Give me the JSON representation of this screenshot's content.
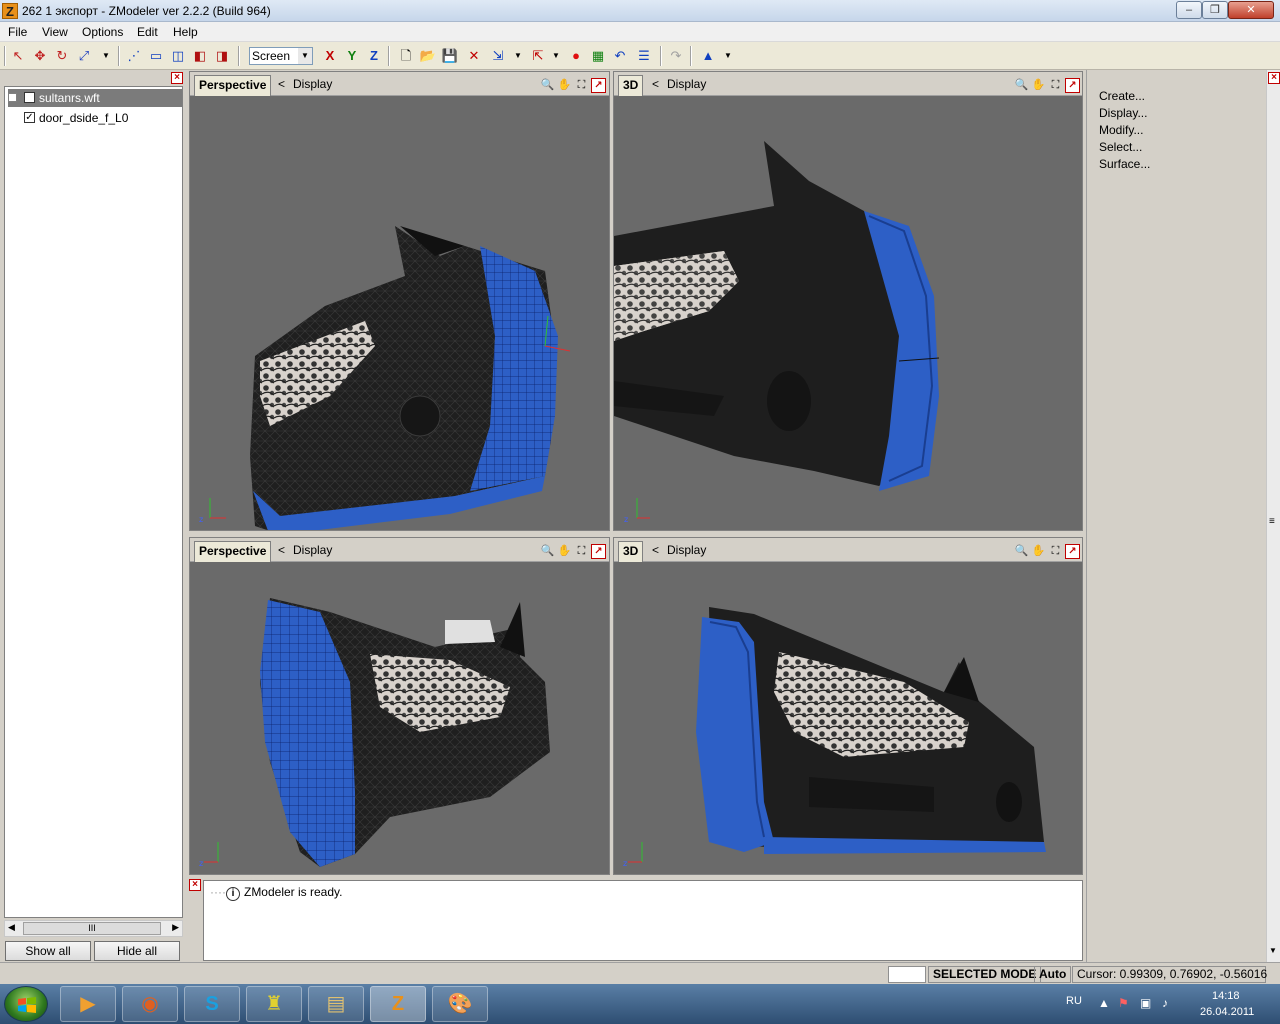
{
  "window": {
    "title": "262 1 экспорт - ZModeler ver 2.2.2 (Build 964)",
    "app_icon_letter": "Z",
    "minimize": "‒",
    "maximize": "❐",
    "close": "✕"
  },
  "menu": [
    "File",
    "View",
    "Options",
    "Edit",
    "Help"
  ],
  "toolbar": {
    "view_mode_value": "Screen",
    "axis_x": "X",
    "axis_y": "Y",
    "axis_z": "Z",
    "icons": [
      "select-icon",
      "move-icon",
      "rotate-icon",
      "scale-icon",
      "new-file-icon",
      "open-icon",
      "save-icon",
      "undo-icon",
      "render-icon"
    ]
  },
  "tree": {
    "items": [
      {
        "label": "sultanrs.wft",
        "checked": false,
        "expand": "+",
        "selected": true
      },
      {
        "label": "door_dside_f_L0",
        "checked": true,
        "expand": "",
        "selected": false
      }
    ],
    "scroll_thumb": "III",
    "show_all": "Show all",
    "hide_all": "Hide all"
  },
  "viewports": [
    {
      "tab": "Perspective",
      "display": "Display"
    },
    {
      "tab": "3D",
      "display": "Display"
    },
    {
      "tab": "Perspective",
      "display": "Display"
    },
    {
      "tab": "3D",
      "display": "Display"
    }
  ],
  "viewport_arrow": "<",
  "log": {
    "message": "ZModeler is ready.",
    "info_icon": "i"
  },
  "right_panel": {
    "items": [
      "Create...",
      "Display...",
      "Modify...",
      "Select...",
      "Surface..."
    ]
  },
  "status": {
    "mode": "SELECTED MODE",
    "auto": "Auto",
    "cursor": "Cursor: 0.99309, 0.76902, -0.56016"
  },
  "taskbar": {
    "lang": "RU",
    "time": "14:18",
    "date": "26.04.2011"
  },
  "colors": {
    "model_blue": "#2d5fc6",
    "model_dark": "#1e1e1e",
    "viewport_bg": "#6a6a6a"
  }
}
